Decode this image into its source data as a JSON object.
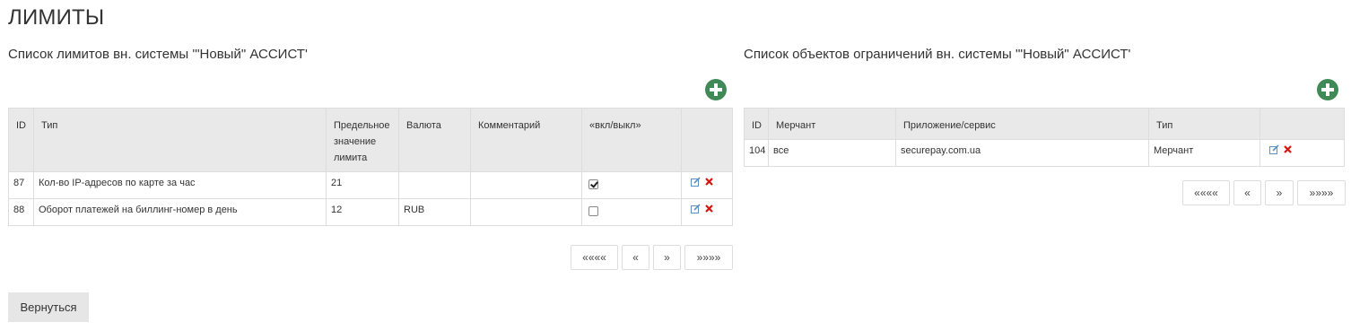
{
  "page": {
    "title": "ЛИМИТЫ"
  },
  "left": {
    "title": "Список лимитов вн. системы '\"Новый\" АССИСТ'",
    "columns": [
      "ID",
      "Тип",
      "Предельное значение лимита",
      "Валюта",
      "Комментарий",
      "«вкл/выкл»",
      ""
    ],
    "rows": [
      {
        "id": "87",
        "type": "Кол-во IP-адресов по карте за час",
        "limit": "21",
        "currency": "",
        "comment": "",
        "enabled": true
      },
      {
        "id": "88",
        "type": "Оборот платежей на биллинг-номер в день",
        "limit": "12",
        "currency": "RUB",
        "comment": "",
        "enabled": false
      }
    ],
    "pager": {
      "first": "««««",
      "prev": "«",
      "next": "»",
      "last": "»»»»"
    }
  },
  "right": {
    "title": "Список объектов ограничений вн. системы '\"Новый\" АССИСТ'",
    "columns": [
      "ID",
      "Мерчант",
      "Приложение/сервис",
      "Тип",
      ""
    ],
    "rows": [
      {
        "id": "104",
        "merchant": "все",
        "app": "securepay.com.ua",
        "type": "Мерчант"
      }
    ],
    "pager": {
      "first": "««««",
      "prev": "«",
      "next": "»",
      "last": "»»»»"
    }
  },
  "back_label": "Вернуться",
  "colors": {
    "add": "#3f8a57",
    "edit": "#5a8fc7",
    "delete": "#d9140e",
    "header_bg": "#e9e9e9"
  },
  "icons": {
    "add": "plus-circle-icon",
    "edit": "pencil-square-icon",
    "delete": "x-icon"
  }
}
